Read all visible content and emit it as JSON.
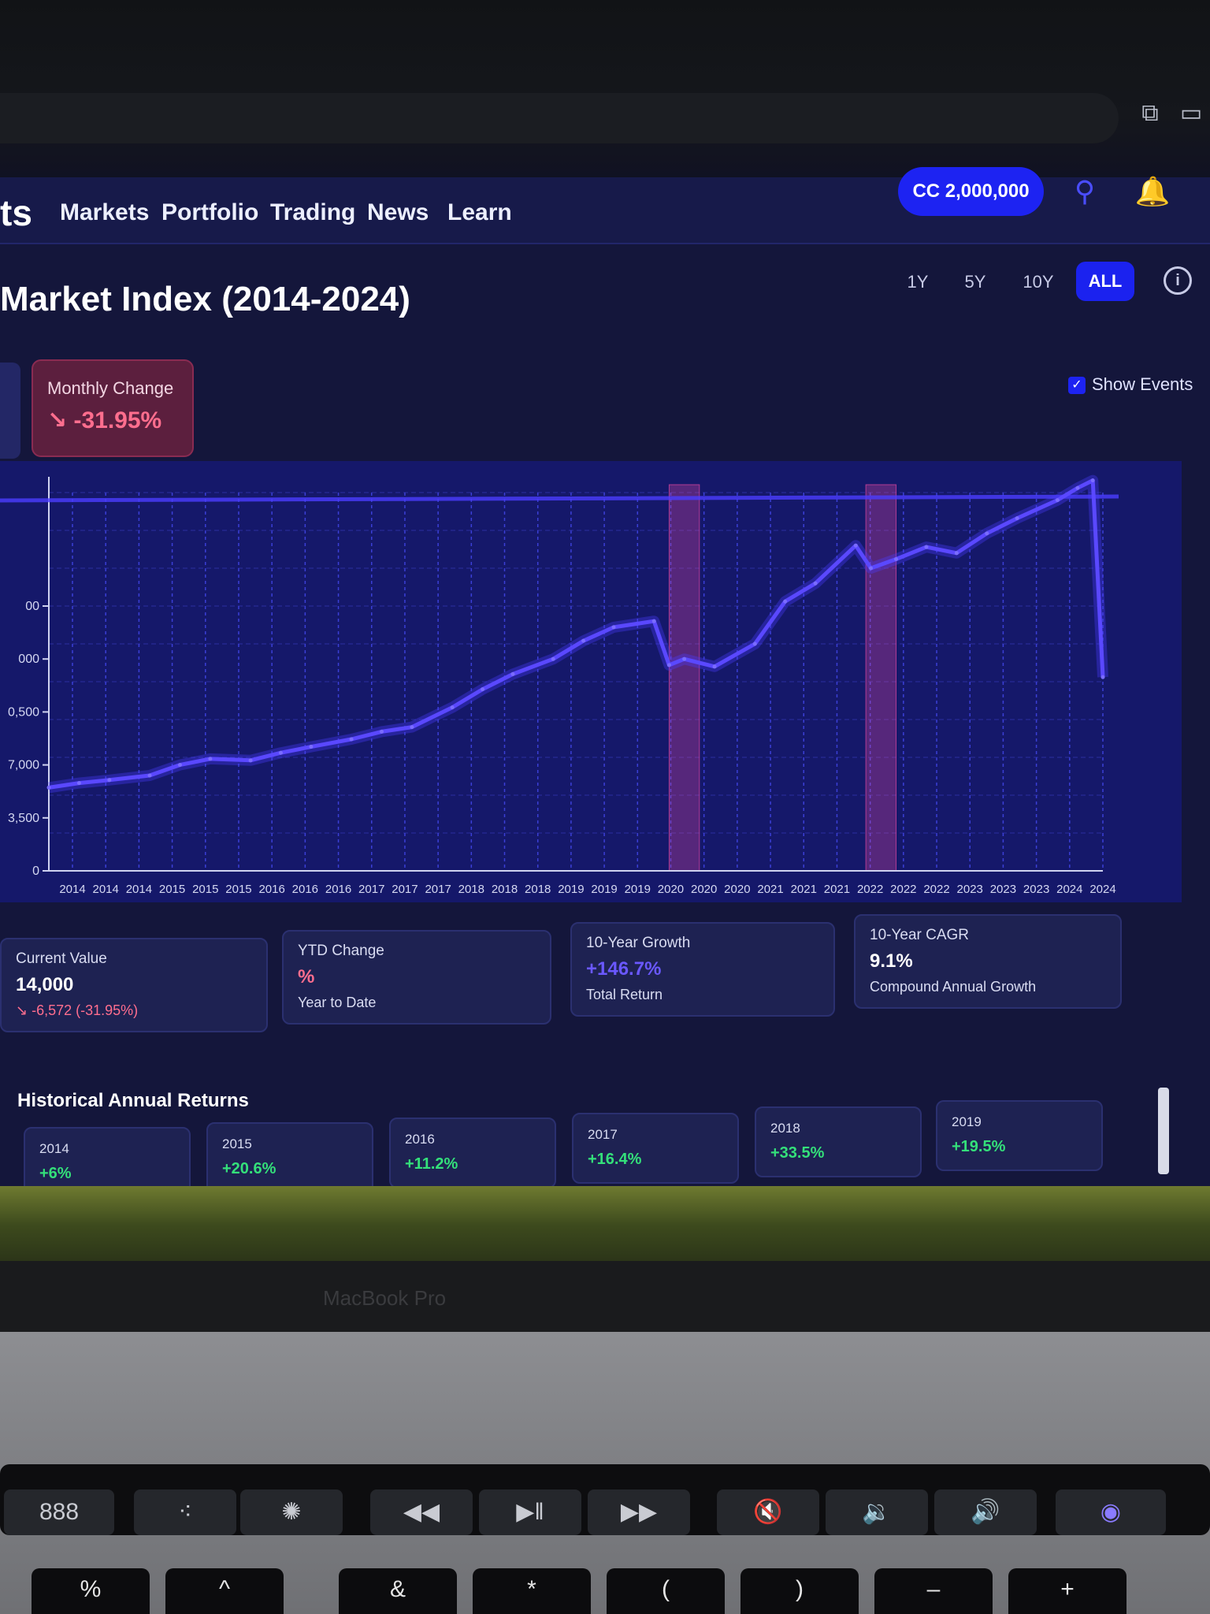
{
  "nav": {
    "brand": "ts",
    "items": [
      "Markets",
      "Portfolio",
      "Trading",
      "News",
      "Learn"
    ],
    "balance": "CC 2,000,000"
  },
  "page": {
    "title": "Market Index (2014-2024)",
    "ranges": [
      "1Y",
      "5Y",
      "10Y",
      "ALL"
    ],
    "active_range": "ALL",
    "info_icon": "i",
    "show_events": "Show Events"
  },
  "monthly": {
    "label": "Monthly Change",
    "value": "-31.95%"
  },
  "stats": {
    "current": {
      "label": "Current Value",
      "value": "14,000",
      "change": "-6,572 (-31.95%)"
    },
    "ytd": {
      "label": "YTD Change",
      "value": "%",
      "sub": "Year to Date"
    },
    "growth": {
      "label": "10-Year Growth",
      "value": "+146.7%",
      "sub": "Total Return"
    },
    "cagr": {
      "label": "10-Year CAGR",
      "value": "9.1%",
      "sub": "Compound Annual Growth"
    }
  },
  "annual": {
    "title": "Historical Annual Returns",
    "items": [
      {
        "year": "2014",
        "ret": "+6%"
      },
      {
        "year": "2015",
        "ret": "+20.6%"
      },
      {
        "year": "2016",
        "ret": "+11.2%"
      },
      {
        "year": "2017",
        "ret": "+16.4%"
      },
      {
        "year": "2018",
        "ret": "+33.5%"
      },
      {
        "year": "2019",
        "ret": "+19.5%"
      }
    ]
  },
  "chart_data": {
    "type": "line",
    "y_tick_labels": [
      "0",
      "3,500",
      "7,000",
      "0,500",
      "000",
      "00"
    ],
    "y_ticks": [
      0,
      3500,
      7000,
      10500,
      14000,
      17500
    ],
    "ylim": [
      0,
      25000
    ],
    "x_tick_labels": [
      "2014",
      "2014",
      "2014",
      "2015",
      "2015",
      "2015",
      "2016",
      "2016",
      "2016",
      "2017",
      "2017",
      "2017",
      "2018",
      "2018",
      "2018",
      "2019",
      "2019",
      "2019",
      "2020",
      "2020",
      "2020",
      "2021",
      "2021",
      "2021",
      "2022",
      "2022",
      "2022",
      "2023",
      "2023",
      "2023",
      "2024",
      "2024"
    ],
    "x": [
      2014.0,
      2014.3,
      2014.6,
      2015.0,
      2015.3,
      2015.6,
      2016.0,
      2016.3,
      2016.6,
      2017.0,
      2017.3,
      2017.6,
      2018.0,
      2018.3,
      2018.6,
      2019.0,
      2019.3,
      2019.6,
      2020.0,
      2020.15,
      2020.3,
      2020.6,
      2021.0,
      2021.3,
      2021.6,
      2022.0,
      2022.15,
      2022.4,
      2022.7,
      2023.0,
      2023.3,
      2023.6,
      2024.0,
      2024.2,
      2024.35,
      2024.45
    ],
    "values": [
      5500,
      5800,
      6000,
      6300,
      7000,
      7400,
      7300,
      7800,
      8200,
      8700,
      9200,
      9500,
      10800,
      12000,
      13000,
      14000,
      15200,
      16100,
      16500,
      13600,
      14000,
      13500,
      15000,
      17800,
      19000,
      21500,
      20000,
      20600,
      21400,
      21000,
      22300,
      23300,
      24500,
      25300,
      25800,
      12800
    ],
    "series_name": "",
    "event_bands": [
      [
        2020.15,
        2020.45
      ],
      [
        2022.1,
        2022.4
      ]
    ],
    "grid": true,
    "colors": {
      "line": "#4b3dff",
      "event": "#ff4fa8",
      "grid": "#3b3fd6"
    }
  },
  "laptop": {
    "model": "MacBook Pro",
    "touchbar": [
      "888",
      "⁖",
      "✺",
      "◀◀",
      "▶‖",
      "▶▶",
      "🔇",
      "🔉",
      "🔊",
      "◉"
    ],
    "keys": [
      "%",
      "^",
      "&",
      "*",
      "(",
      ")",
      "–",
      "+"
    ]
  }
}
